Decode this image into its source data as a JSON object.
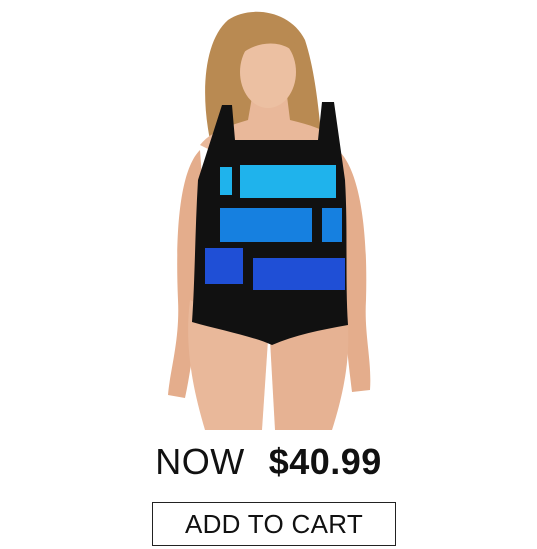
{
  "product": {
    "image_alt": "model wearing color-block one-piece swimsuit",
    "price_prefix": "NOW",
    "price": "$40.99",
    "add_to_cart_label": "ADD TO CART"
  },
  "colors": {
    "swimsuit_black": "#111111",
    "panel_light_blue": "#1fb3ec",
    "panel_mid_blue": "#1680e0",
    "panel_deep_blue": "#1f4fd6",
    "skin": "#e9b89a",
    "hair": "#b98a52"
  }
}
